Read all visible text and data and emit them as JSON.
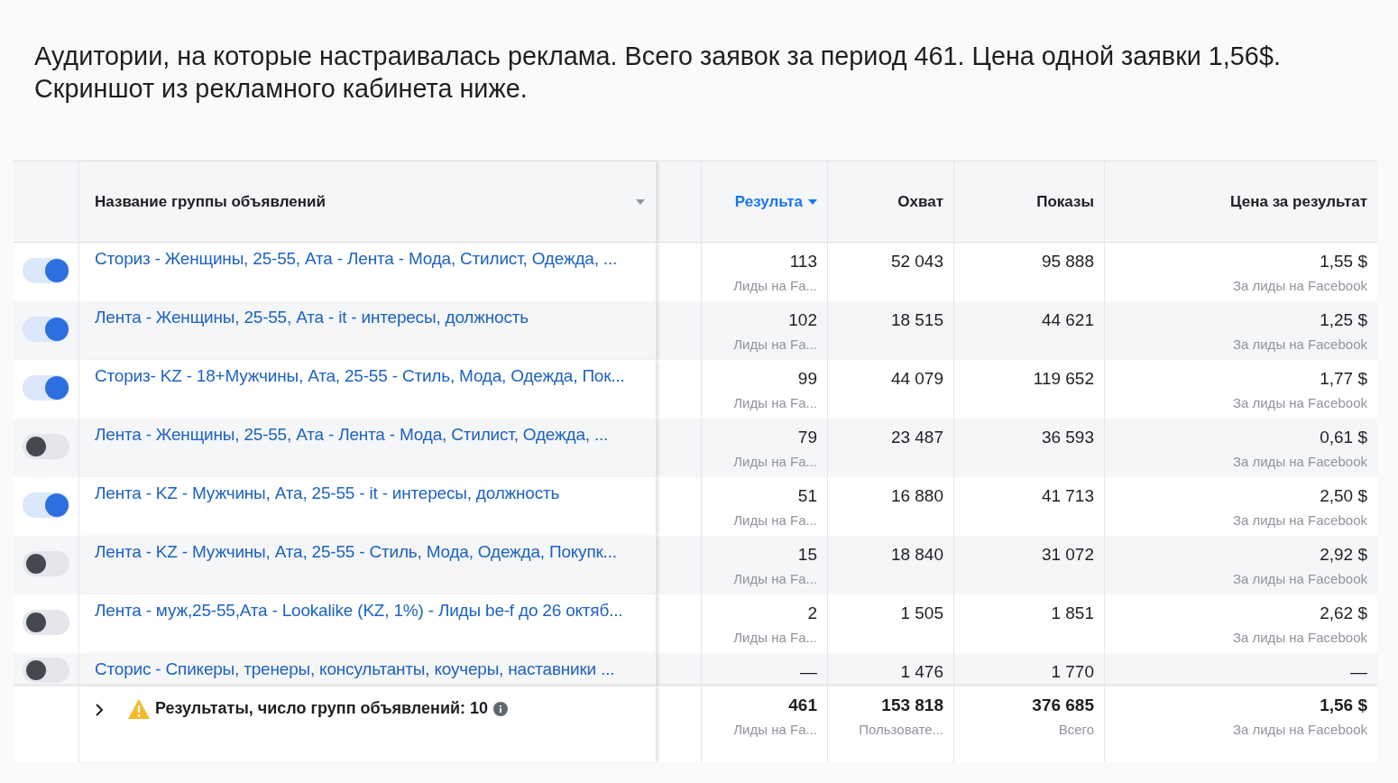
{
  "intro": "Аудитории, на которые настраивалась реклама. Всего заявок за период 461.  Цена одной заявки 1,56$. Скриншот из рекламного кабинета ниже.",
  "table": {
    "columns": [
      {
        "kind": "name",
        "label": "Название группы объявлений",
        "sorted": false
      },
      {
        "kind": "metric",
        "label": "Результа",
        "sorted": true
      },
      {
        "kind": "metric",
        "label": "Охват",
        "sorted": false
      },
      {
        "kind": "metric",
        "label": "Показы",
        "sorted": false
      },
      {
        "kind": "metric",
        "label": "Цена за результат",
        "sorted": false
      }
    ],
    "rows": [
      {
        "on": true,
        "name": "Сториз - Женщины, 25-55, Ата - Лента - Мода, Стилист, Одежда, ...",
        "results": "113",
        "results_label": "Лиды на Fa...",
        "reach": "52 043",
        "impressions": "95 888",
        "cost": "1,55 $",
        "cost_label": "За лиды на Facebook"
      },
      {
        "on": true,
        "name": "Лента - Женщины, 25-55, Ата - it - интересы, должность",
        "results": "102",
        "results_label": "Лиды на Fa...",
        "reach": "18 515",
        "impressions": "44 621",
        "cost": "1,25 $",
        "cost_label": "За лиды на Facebook"
      },
      {
        "on": true,
        "name": "Сториз- KZ - 18+Мужчины, Ата, 25-55 - Стиль, Мода, Одежда, Пок...",
        "results": "99",
        "results_label": "Лиды на Fa...",
        "reach": "44 079",
        "impressions": "119 652",
        "cost": "1,77 $",
        "cost_label": "За лиды на Facebook"
      },
      {
        "on": false,
        "name": "Лента - Женщины, 25-55, Ата - Лента - Мода, Стилист, Одежда, ...",
        "results": "79",
        "results_label": "Лиды на Fa...",
        "reach": "23 487",
        "impressions": "36 593",
        "cost": "0,61 $",
        "cost_label": "За лиды на Facebook"
      },
      {
        "on": true,
        "name": "Лента - KZ - Мужчины, Ата, 25-55 - it - интересы, должность",
        "results": "51",
        "results_label": "Лиды на Fa...",
        "reach": "16 880",
        "impressions": "41 713",
        "cost": "2,50 $",
        "cost_label": "За лиды на Facebook"
      },
      {
        "on": false,
        "name": "Лента - KZ - Мужчины, Ата, 25-55 - Стиль, Мода, Одежда, Покупк...",
        "results": "15",
        "results_label": "Лиды на Fa...",
        "reach": "18 840",
        "impressions": "31 072",
        "cost": "2,92 $",
        "cost_label": "За лиды на Facebook"
      },
      {
        "on": false,
        "name": "Лента - муж,25-55,Ата - Lookalike (KZ, 1%) - Лиды be-f до 26 октяб...",
        "results": "2",
        "results_label": "Лиды на Fa...",
        "reach": "1 505",
        "impressions": "1 851",
        "cost": "2,62 $",
        "cost_label": "За лиды на Facebook"
      },
      {
        "on": false,
        "name": "Сторис - Спикеры, тренеры, консультанты, коучеры, наставники ...",
        "results": "—",
        "reach": "1 476",
        "impressions": "1 770",
        "cost": "—"
      }
    ],
    "summary": {
      "label": "Результаты, число групп объявлений: 10",
      "results": "461",
      "results_label": "Лиды на Fa...",
      "reach": "153 818",
      "reach_label": "Пользовате...",
      "impressions": "376 685",
      "impressions_label": "Всего",
      "cost": "1,56 $",
      "cost_label": "За лиды на Facebook"
    }
  }
}
